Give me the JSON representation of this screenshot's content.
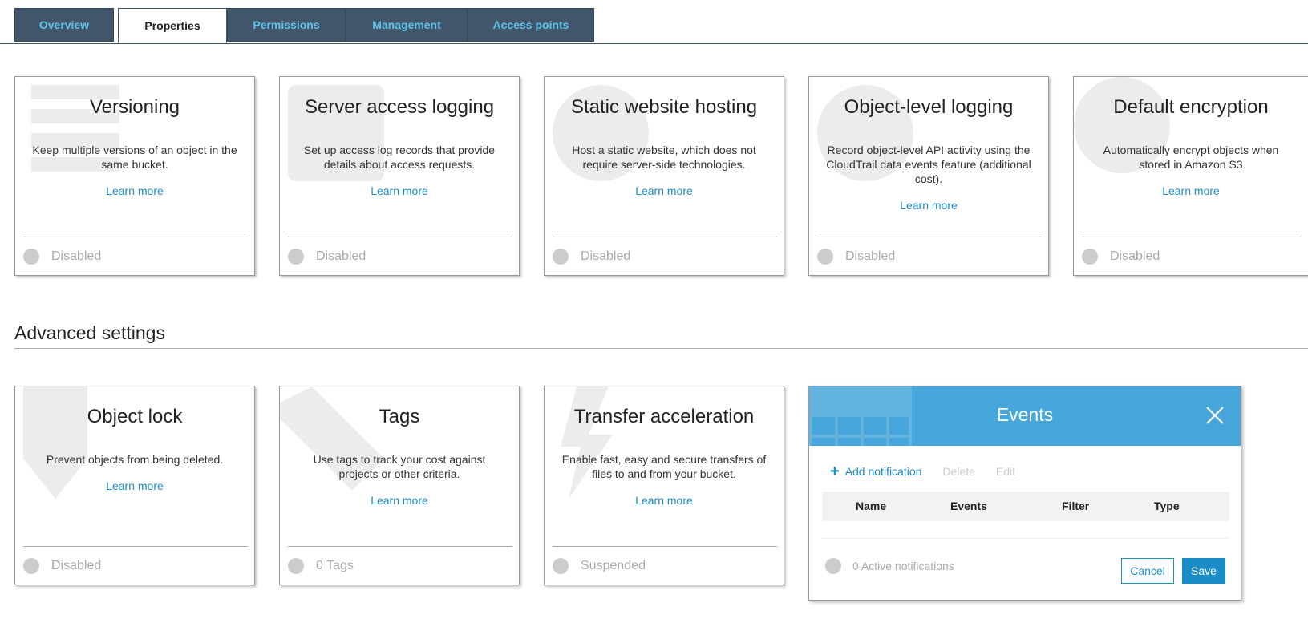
{
  "tabs": [
    {
      "label": "Overview"
    },
    {
      "label": "Properties",
      "active": true
    },
    {
      "label": "Permissions"
    },
    {
      "label": "Management"
    },
    {
      "label": "Access points"
    }
  ],
  "cards": [
    {
      "title": "Versioning",
      "desc": "Keep multiple versions of an object in the same bucket.",
      "learn": "Learn more",
      "status": "Disabled",
      "icon": "versioning-icon"
    },
    {
      "title": "Server access logging",
      "desc": "Set up access log records that provide details about access requests.",
      "learn": "Learn more",
      "status": "Disabled",
      "icon": "logging-icon"
    },
    {
      "title": "Static website hosting",
      "desc": "Host a static website, which does not require server-side technologies.",
      "learn": "Learn more",
      "status": "Disabled",
      "icon": "globe-icon"
    },
    {
      "title": "Object-level logging",
      "desc": "Record object-level API activity using the CloudTrail data events feature (additional cost).",
      "learn": "Learn more",
      "status": "Disabled",
      "icon": "logging-icon"
    },
    {
      "title": "Default encryption",
      "desc": "Automatically encrypt objects when stored in Amazon S3",
      "learn": "Learn more",
      "status": "Disabled",
      "icon": "encryption-icon"
    }
  ],
  "advanced": {
    "heading": "Advanced settings",
    "cards": [
      {
        "title": "Object lock",
        "desc": "Prevent objects from being deleted.",
        "learn": "Learn more",
        "status": "Disabled",
        "icon": "shield-icon"
      },
      {
        "title": "Tags",
        "desc": "Use tags to track your cost against projects or other criteria.",
        "learn": "Learn more",
        "status": "0 Tags",
        "icon": "tag-icon"
      },
      {
        "title": "Transfer acceleration",
        "desc": "Enable fast, easy and secure transfers of files to and from your bucket.",
        "learn": "Learn more",
        "status": "Suspended",
        "icon": "lightning-icon"
      }
    ]
  },
  "events": {
    "title": "Events",
    "add": "Add notification",
    "delete": "Delete",
    "edit": "Edit",
    "columns": [
      "Name",
      "Events",
      "Filter",
      "Type"
    ],
    "active_text": "0 Active notifications",
    "cancel": "Cancel",
    "save": "Save"
  },
  "colors": {
    "tab_bg": "#41566a",
    "tab_text": "#5fc3ec",
    "link": "#1a8dc7",
    "events_header": "#46a6db"
  }
}
